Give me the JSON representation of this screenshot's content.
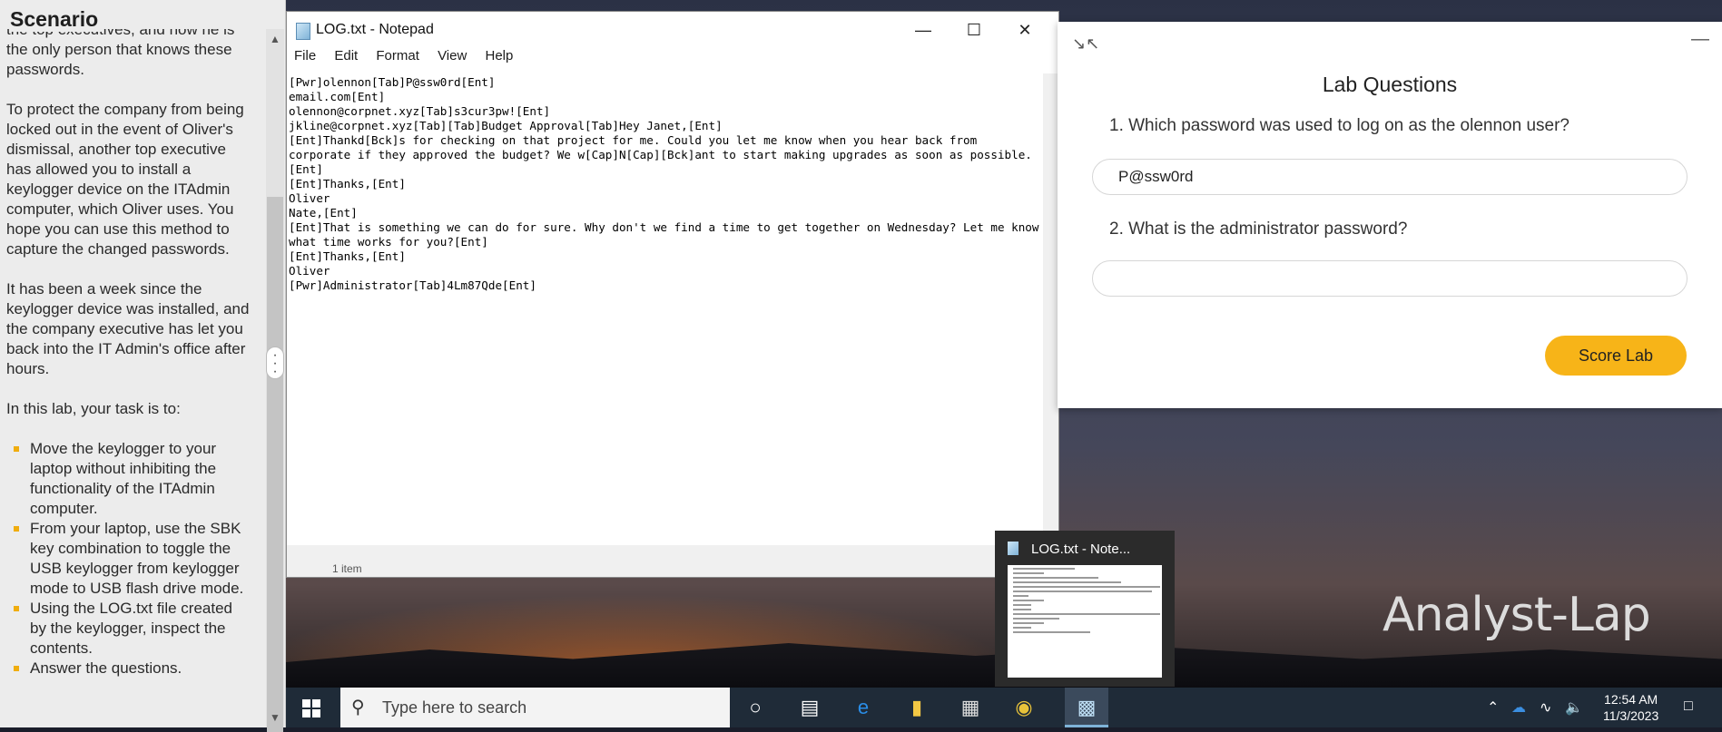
{
  "scenario": {
    "title": "Scenario",
    "cut_line": "the top executives, and now he is the only person that knows these passwords.",
    "para1": "To protect the company from being locked out in the event of Oliver's dismissal, another top executive has allowed you to install a keylogger device on the ITAdmin computer, which Oliver uses. You hope you can use this method to capture the changed passwords.",
    "para2": "It has been a week since the keylogger device was installed, and the company executive has let you back into the IT Admin's office after hours.",
    "para3": "In this lab, your task is to:",
    "tasks": [
      "Move the keylogger to your laptop without inhibiting the functionality of the ITAdmin computer.",
      "From your laptop, use the SBK key combination to toggle the USB keylogger from keylogger mode to USB flash drive mode.",
      "Using the LOG.txt file created by the keylogger, inspect the contents.",
      "Answer the questions."
    ]
  },
  "notepad": {
    "title": "LOG.txt - Notepad",
    "menu": [
      "File",
      "Edit",
      "Format",
      "View",
      "Help"
    ],
    "lines": [
      "[Pwr]olennon[Tab]P@ssw0rd[Ent]",
      "email.com[Ent]",
      "olennon@corpnet.xyz[Tab]s3cur3pw![Ent]",
      "jkline@corpnet.xyz[Tab][Tab]Budget Approval[Tab]Hey Janet,[Ent]",
      "[Ent]Thankd[Bck]s for checking on that project for me. Could you let me know when you hear back from",
      "corporate if they approved the budget? We w[Cap]N[Cap][Bck]ant to start making upgrades as soon as possible.",
      "[Ent]",
      "[Ent]Thanks,[Ent]",
      "Oliver",
      "Nate,[Ent]",
      "[Ent]That is something we can do for sure. Why don't we find a time to get together on Wednesday? Let me know",
      "what time works for you?[Ent]",
      "[Ent]Thanks,[Ent]",
      "Oliver",
      "[Pwr]Administrator[Tab]4Lm87Qde[Ent]"
    ],
    "status_text": "1 item"
  },
  "lab": {
    "heading": "Lab Questions",
    "q1": "1. Which password was used to log on as the olennon user?",
    "a1": "P@ssw0rd",
    "q2": "2. What is the administrator password?",
    "a2": "",
    "score_label": "Score Lab"
  },
  "thumbnail": {
    "title": "LOG.txt - Note..."
  },
  "desktop": {
    "hostname": "Analyst-Lap"
  },
  "taskbar": {
    "search_placeholder": "Type here to search",
    "time": "12:54 AM",
    "date": "11/3/2023"
  },
  "colors": {
    "accent": "#f7b418",
    "taskbar": "#1f2b38",
    "bullet": "#f0ad0e"
  }
}
